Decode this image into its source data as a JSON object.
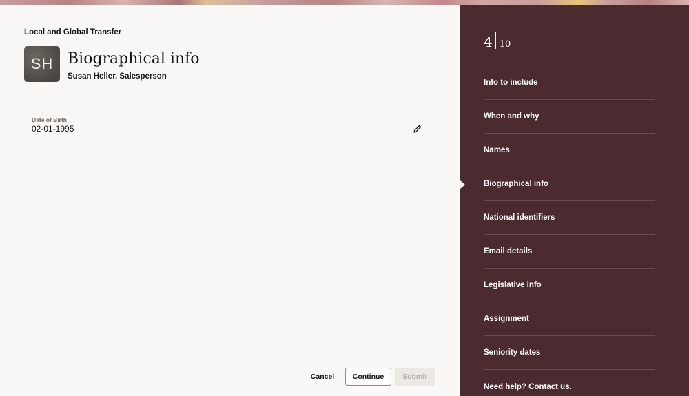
{
  "header": {
    "flow_title": "Local and Global Transfer",
    "page_title": "Biographical info",
    "person": "Susan Heller, Salesperson",
    "avatar_initials": "SH"
  },
  "fields": {
    "date_of_birth_label": "Date of Birth",
    "date_of_birth_value": "02-01-1995"
  },
  "actions": {
    "cancel": "Cancel",
    "continue": "Continue",
    "submit": "Submit"
  },
  "progress": {
    "current": "4",
    "total": "10"
  },
  "nav": {
    "items": [
      {
        "label": "Info to include"
      },
      {
        "label": "When and why"
      },
      {
        "label": "Names"
      },
      {
        "label": "Biographical info"
      },
      {
        "label": "National identifiers"
      },
      {
        "label": "Email details"
      },
      {
        "label": "Legislative info"
      },
      {
        "label": "Assignment"
      },
      {
        "label": "Seniority dates"
      },
      {
        "label": "Need help? Contact us."
      }
    ]
  },
  "colors": {
    "side_panel": "#4b2b2f",
    "background": "#f9f8f6",
    "avatar": "#4d4a45"
  },
  "icons": {
    "edit": "pencil-icon"
  }
}
